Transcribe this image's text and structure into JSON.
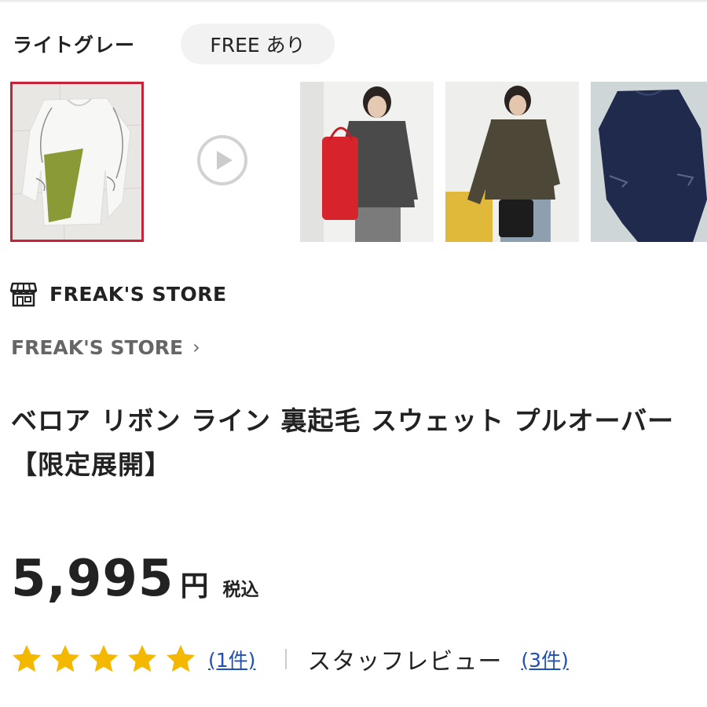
{
  "selected_color": "ライトグレー",
  "size_chip": "FREE あり",
  "thumbnails": [
    {
      "icon": "sweatshirt-flatlay-image",
      "selected": true
    },
    {
      "icon": "play-icon"
    },
    {
      "icon": "model-grey-sweat-image"
    },
    {
      "icon": "model-khaki-sweat-image"
    },
    {
      "icon": "navy-sweat-image"
    }
  ],
  "shop": {
    "name": "FREAK'S STORE",
    "icon": "store-icon"
  },
  "brand_link": {
    "label": "FREAK'S STORE",
    "chevron": "›"
  },
  "product": {
    "title": "ベロア リボン ライン 裏起毛 スウェット プルオーバー【限定展開】"
  },
  "price": {
    "value": "5,995",
    "unit": "円",
    "tax": "税込"
  },
  "reviews": {
    "rating": 5,
    "count": "(1件)",
    "separator": "|",
    "staff_label": "スタッフレビュー",
    "staff_count": "(3件)"
  },
  "colors": {
    "accent": "#c8213a",
    "link": "#1f4fb8",
    "star": "#f5b800",
    "chip_bg": "#f2f2f2"
  }
}
